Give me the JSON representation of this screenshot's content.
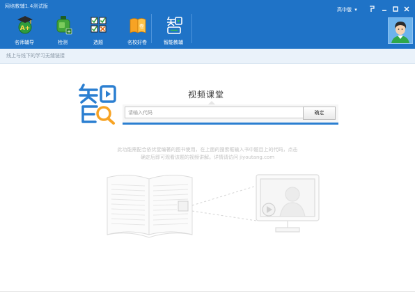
{
  "app": {
    "title": "网络教辅1.4测试版",
    "version_label": "高中版"
  },
  "nav": [
    {
      "id": "famous-tutor",
      "label": "名师辅导",
      "icon": "graduate-cap-icon"
    },
    {
      "id": "detect",
      "label": "检测",
      "icon": "ink-bottle-icon"
    },
    {
      "id": "choose",
      "label": "选题",
      "icon": "checklist-icon"
    },
    {
      "id": "good-papers",
      "label": "名校好卷",
      "icon": "paper-book-icon"
    },
    {
      "id": "smart-tutor",
      "label": "智能教辅",
      "icon": "zhi-logo-icon",
      "active": true
    }
  ],
  "window_controls": {
    "menu": "▾",
    "pin": "ᴾ",
    "min": "–",
    "max": "□",
    "close": "✕"
  },
  "subbar": {
    "text": "线上与线下的学习无缝链接"
  },
  "main": {
    "title": "视频课堂",
    "search_placeholder": "请输入代码",
    "ok_label": "确定",
    "desc_line1": "此功能需配合依优堂编著的图书使用，在上面的搜索框输入书中题目上的代码，点击",
    "desc_line2": "确定后即可观看该题的视频讲解。详情请访问 jiyoutang.com"
  },
  "colors": {
    "brand_blue": "#1f73c7",
    "accent_blue": "#2b7fd1",
    "logo_orange": "#f7a324"
  }
}
